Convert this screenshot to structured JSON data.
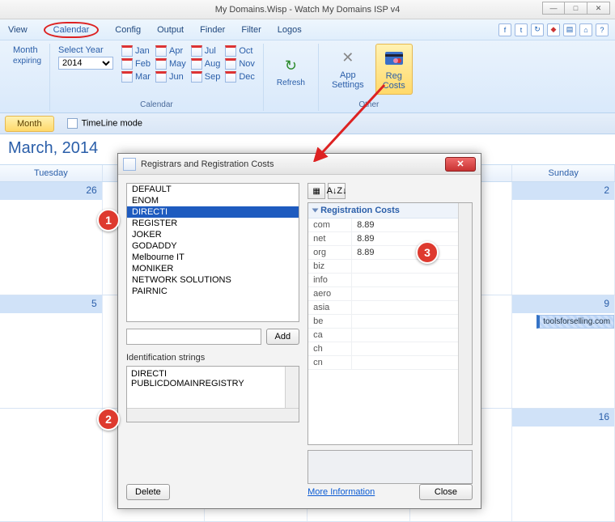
{
  "window": {
    "title": "My Domains.Wisp - Watch My Domains ISP v4"
  },
  "menu": {
    "items": [
      "View",
      "Calendar",
      "Config",
      "Output",
      "Finder",
      "Filter",
      "Logos"
    ],
    "active": "Calendar"
  },
  "ribbon": {
    "month_label1": "Month",
    "month_label2": "expiring",
    "selectyear_label": "Select Year",
    "year": "2014",
    "months": [
      "Jan",
      "Feb",
      "Mar",
      "Apr",
      "May",
      "Jun",
      "Jul",
      "Aug",
      "Sep",
      "Oct",
      "Nov",
      "Dec"
    ],
    "calendar_group_label": "Calendar",
    "refresh": "Refresh",
    "appsettings_line1": "App",
    "appsettings_line2": "Settings",
    "regcosts_line1": "Reg",
    "regcosts_line2": "Costs",
    "other_group_label": "Other"
  },
  "substrip": {
    "month_btn": "Month",
    "timeline": "TimeLine mode"
  },
  "calendar": {
    "heading": "March, 2014",
    "day_headers": [
      "Tuesday",
      "",
      "",
      "",
      "",
      "Sunday"
    ],
    "rows": [
      {
        "nums": [
          "26",
          "",
          "",
          "",
          "",
          "2"
        ]
      },
      {
        "nums": [
          "5",
          "",
          "",
          "",
          "",
          "9"
        ],
        "event_day_index": 5,
        "event_text": "toolsforselling.com"
      },
      {
        "nums": [
          "",
          "",
          "",
          "",
          "",
          "16"
        ]
      }
    ]
  },
  "dialog": {
    "title": "Registrars and Registration Costs",
    "registrars": [
      "DEFAULT",
      "ENOM",
      "DIRECTI",
      "REGISTER",
      "JOKER",
      "GODADDY",
      "Melbourne IT",
      "MONIKER",
      "NETWORK SOLUTIONS",
      "PAIRNIC"
    ],
    "selected_registrar": "DIRECTI",
    "add_btn": "Add",
    "id_strings_label": "Identification strings",
    "id_strings": [
      "DIRECTI",
      "PUBLICDOMAINREGISTRY"
    ],
    "delete_btn": "Delete",
    "more_info": "More Information",
    "close_btn": "Close",
    "prop_header": "Registration Costs",
    "costs": [
      {
        "tld": "com",
        "price": "8.89"
      },
      {
        "tld": "net",
        "price": "8.89"
      },
      {
        "tld": "org",
        "price": "8.89"
      },
      {
        "tld": "biz",
        "price": ""
      },
      {
        "tld": "info",
        "price": ""
      },
      {
        "tld": "aero",
        "price": ""
      },
      {
        "tld": "asia",
        "price": ""
      },
      {
        "tld": "be",
        "price": ""
      },
      {
        "tld": "ca",
        "price": ""
      },
      {
        "tld": "ch",
        "price": ""
      },
      {
        "tld": "cn",
        "price": ""
      }
    ],
    "sort_az": "A↓Z↓"
  },
  "badges": {
    "b1": "1",
    "b2": "2",
    "b3": "3"
  }
}
